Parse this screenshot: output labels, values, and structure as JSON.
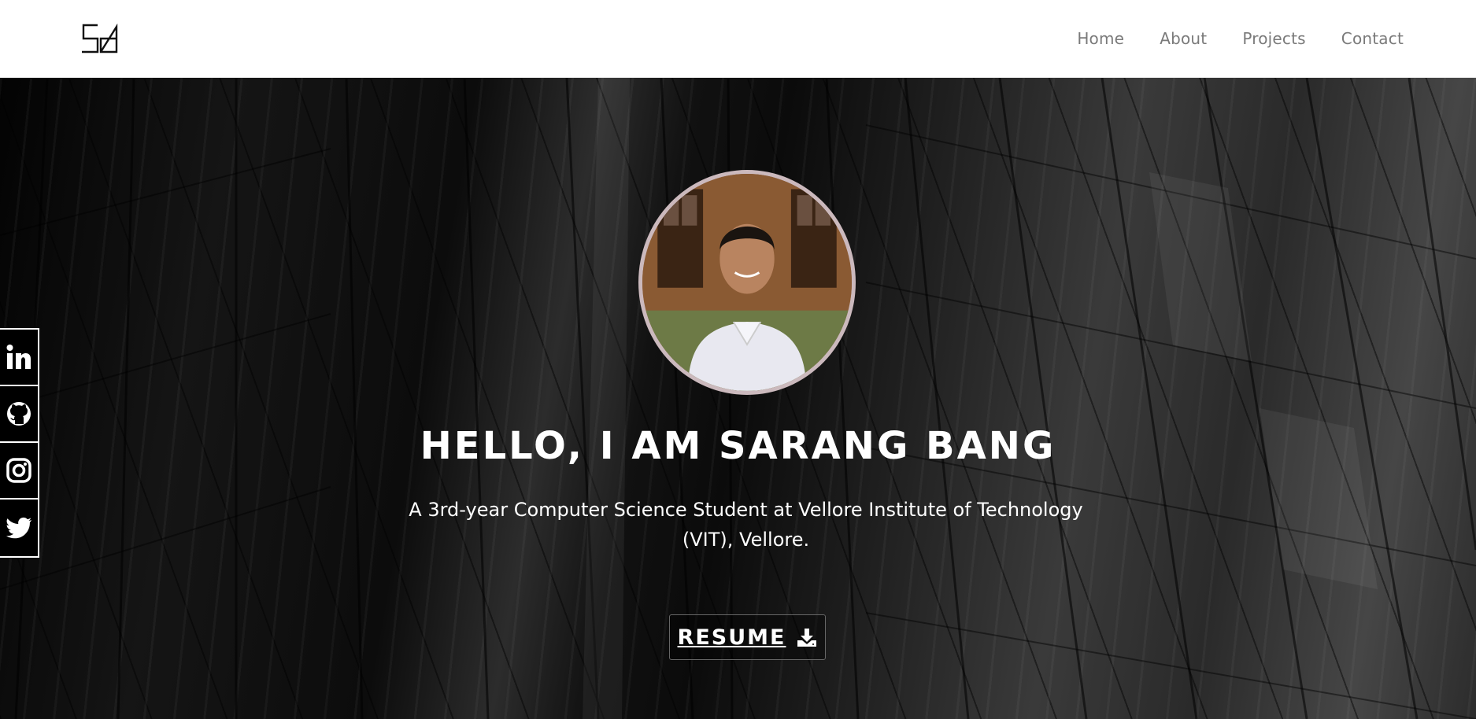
{
  "header": {
    "logo_icon": "sb-monogram-logo",
    "nav": [
      {
        "label": "Home"
      },
      {
        "label": "About"
      },
      {
        "label": "Projects"
      },
      {
        "label": "Contact"
      }
    ]
  },
  "hero": {
    "headline": "HELLO, I AM SARANG BANG",
    "subtitle": "A 3rd-year Computer Science Student at Vellore Institute of Technology (VIT), Vellore.",
    "resume_label": "RESUME",
    "resume_icon": "download-icon",
    "avatar_icon": "profile-photo"
  },
  "social": [
    {
      "icon": "linkedin-icon"
    },
    {
      "icon": "github-icon"
    },
    {
      "icon": "instagram-icon"
    },
    {
      "icon": "twitter-icon"
    }
  ],
  "colors": {
    "header_bg": "#ffffff",
    "nav_text": "#7a7a7a",
    "hero_text": "#ffffff",
    "avatar_border": "#cbb9bd"
  }
}
